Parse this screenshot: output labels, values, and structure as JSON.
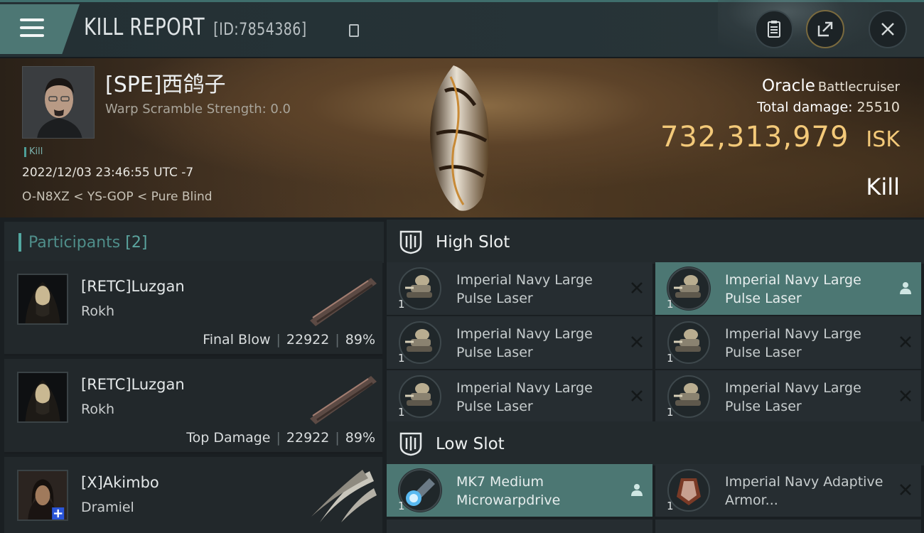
{
  "header": {
    "title": "KILL REPORT",
    "report_id": "[ID:7854386]"
  },
  "victim": {
    "name": "[SPE]西鸽子",
    "warp_scramble": "Warp Scramble Strength: 0.0",
    "tag": "Kill",
    "time": "2022/12/03 23:46:55 UTC -7",
    "location": "O-N8XZ < YS-GOP < Pure Blind",
    "ship_name": "Oracle",
    "ship_class": "Battlecruiser",
    "damage_label": "Total damage:",
    "damage_value": "25510",
    "isk_value": "732,313,979",
    "isk_unit": "ISK",
    "result": "Kill"
  },
  "participants": {
    "label": "Participants",
    "count": "[2]",
    "rows": [
      {
        "name": "[RETC]Luzgan",
        "ship": "Rokh",
        "role": "Final Blow",
        "damage": "22922",
        "percent": "89%"
      },
      {
        "name": "[RETC]Luzgan",
        "ship": "Rokh",
        "role": "Top Damage",
        "damage": "22922",
        "percent": "89%"
      },
      {
        "name": "[X]Akimbo",
        "ship": "Dramiel",
        "role": "",
        "damage": "",
        "percent": ""
      }
    ]
  },
  "fitting": {
    "high_slot": {
      "label": "High Slot",
      "modules": [
        {
          "name": "Imperial Navy Large Pulse Laser",
          "qty": "1",
          "status": "destroyed"
        },
        {
          "name": "Imperial Navy Large Pulse Laser",
          "qty": "1",
          "status": "dropped"
        },
        {
          "name": "Imperial Navy Large Pulse Laser",
          "qty": "1",
          "status": "destroyed"
        },
        {
          "name": "Imperial Navy Large Pulse Laser",
          "qty": "1",
          "status": "destroyed"
        },
        {
          "name": "Imperial Navy Large Pulse Laser",
          "qty": "1",
          "status": "destroyed"
        },
        {
          "name": "Imperial Navy Large Pulse Laser",
          "qty": "1",
          "status": "destroyed"
        }
      ]
    },
    "low_slot": {
      "label": "Low Slot",
      "modules": [
        {
          "name": "MK7 Medium Microwarpdrive",
          "qty": "1",
          "status": "dropped"
        },
        {
          "name": "Imperial Navy Adaptive Armor...",
          "qty": "1",
          "status": "destroyed"
        }
      ]
    }
  },
  "colors": {
    "accent_teal": "#4c7773",
    "isk_gold": "#f3c979",
    "participants_label": "#4f8e8a"
  },
  "icons": [
    "menu-icon",
    "copy-icon",
    "clipboard-icon",
    "share-icon",
    "close-icon",
    "slot-icon",
    "destroyed-x-icon",
    "dropped-person-icon"
  ]
}
